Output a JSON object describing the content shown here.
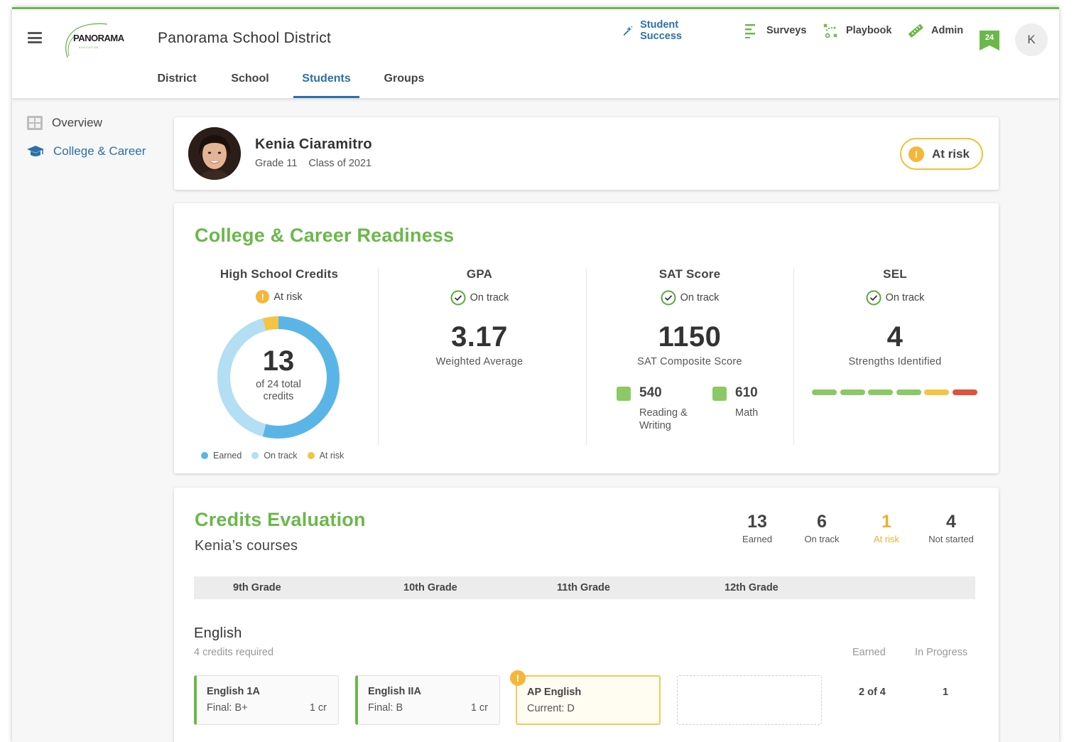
{
  "header": {
    "logo_text": "PANORAMA",
    "logo_sub": "EDUCATION",
    "district": "Panorama School District",
    "nav": [
      {
        "label": "Student Success",
        "icon": "sparkle-icon"
      },
      {
        "label": "Surveys",
        "icon": "list-icon"
      },
      {
        "label": "Playbook",
        "icon": "playbook-icon"
      },
      {
        "label": "Admin",
        "icon": "ruler-icon"
      }
    ],
    "badge_count": "24",
    "user_initial": "K",
    "tabs": [
      "District",
      "School",
      "Students",
      "Groups"
    ],
    "active_tab": "Students"
  },
  "sidebar": {
    "items": [
      {
        "label": "Overview",
        "icon": "overview-icon"
      },
      {
        "label": "College & Career",
        "icon": "graduation-cap-icon"
      }
    ],
    "active": "College & Career"
  },
  "student": {
    "name": "Kenia Ciaramitro",
    "grade": "Grade 11",
    "class_of": "Class of 2021",
    "status": "At risk"
  },
  "readiness": {
    "title": "College & Career Readiness",
    "credits": {
      "title": "High School Credits",
      "status": "At risk",
      "value": "13",
      "label": "of 24 total credits",
      "legend": [
        "Earned",
        "On track",
        "At risk"
      ]
    },
    "gpa": {
      "title": "GPA",
      "status": "On track",
      "value": "3.17",
      "label": "Weighted Average"
    },
    "sat": {
      "title": "SAT Score",
      "status": "On track",
      "value": "1150",
      "label": "SAT Composite Score",
      "reading": {
        "value": "540",
        "label_1": "Reading &",
        "label_2": "Writing"
      },
      "math": {
        "value": "610",
        "label": "Math"
      }
    },
    "sel": {
      "title": "SEL",
      "status": "On track",
      "value": "4",
      "label": "Strengths Identified"
    }
  },
  "chart_data": {
    "type": "pie",
    "categories": [
      "Earned",
      "On track",
      "At risk"
    ],
    "values": [
      13,
      10,
      1
    ],
    "total": 24,
    "colors": [
      "#5ab5e6",
      "#b3def3",
      "#f4c542"
    ]
  },
  "sel_strengths": {
    "levels": [
      "green",
      "green",
      "green",
      "green",
      "yellow",
      "red"
    ],
    "colors": {
      "green": "#8bc866",
      "yellow": "#f4c542",
      "red": "#e0533a"
    }
  },
  "credits_eval": {
    "title": "Credits Evaluation",
    "subtitle": "Kenia’s courses",
    "stats": [
      {
        "value": "13",
        "label": "Earned"
      },
      {
        "value": "6",
        "label": "On track"
      },
      {
        "value": "1",
        "label": "At risk"
      },
      {
        "value": "4",
        "label": "Not started"
      }
    ],
    "grades": [
      "9th Grade",
      "10th Grade",
      "11th Grade",
      "12th Grade"
    ],
    "subject": {
      "name": "English",
      "required": "4 credits required",
      "col_earned": "Earned",
      "col_progress": "In Progress",
      "earned": "2 of 4",
      "in_progress": "1",
      "courses": [
        {
          "name": "English 1A",
          "grade": "Final: B+",
          "credits": "1 cr"
        },
        {
          "name": "English IIA",
          "grade": "Final: B",
          "credits": "1 cr"
        },
        {
          "name": "AP English",
          "grade": "Current: D",
          "credits": ""
        }
      ]
    }
  }
}
